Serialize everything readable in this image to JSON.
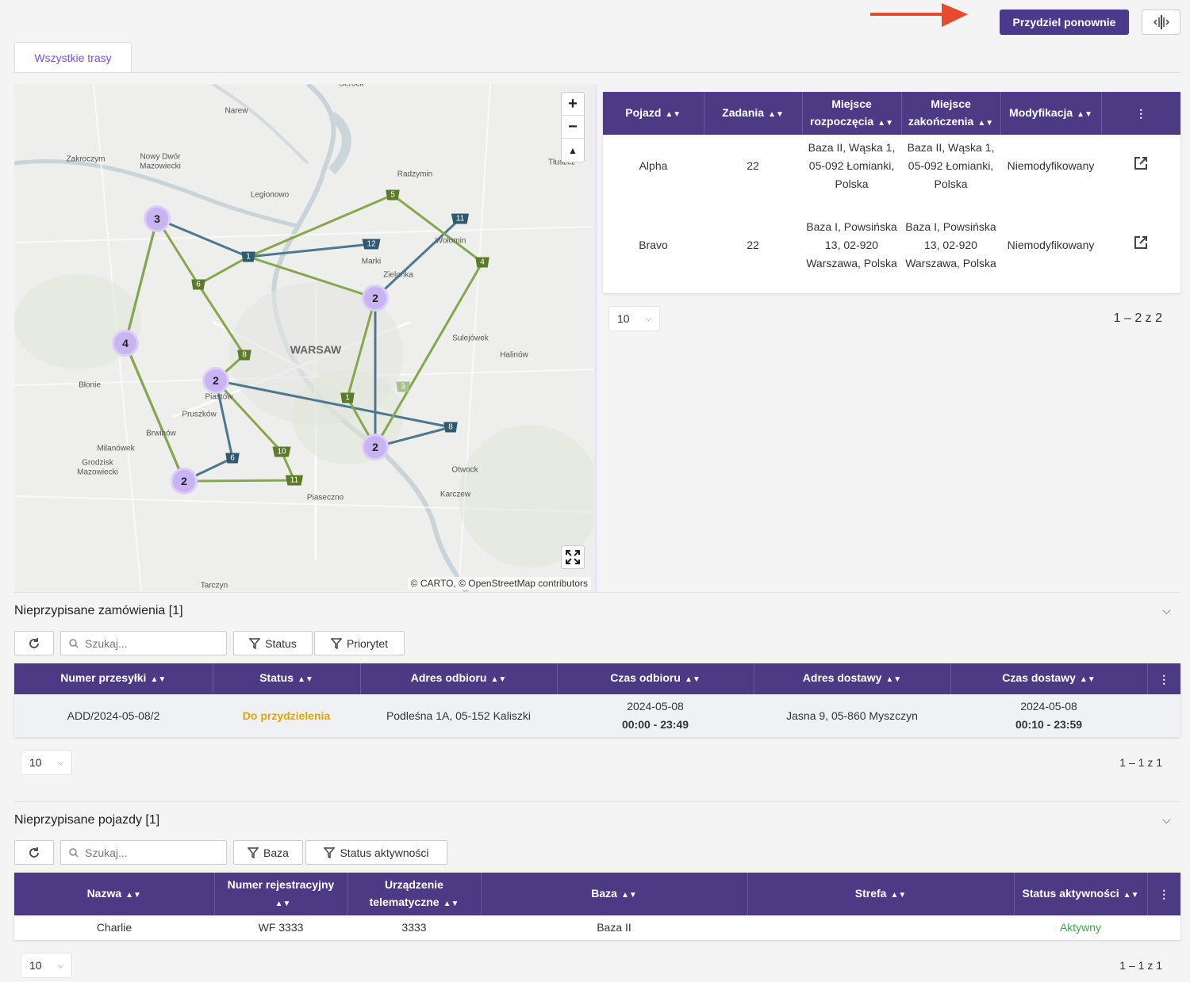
{
  "header": {
    "reassign_label": "Przydziel ponownie",
    "split_icon": "split-view-icon"
  },
  "tabs": [
    {
      "label": "Wszystkie trasy"
    }
  ],
  "map": {
    "attribution": "© CARTO, © OpenStreetMap contributors",
    "zoom_in": "+",
    "zoom_out": "−",
    "north": "▲",
    "places": [
      {
        "name": "Serock"
      },
      {
        "name": "Narew"
      },
      {
        "name": "Zakroczym"
      },
      {
        "name": "Nowy Dwór"
      },
      {
        "name": "Mazowiecki"
      },
      {
        "name": "Radzymin"
      },
      {
        "name": "Tłuszcz"
      },
      {
        "name": "Legionowo"
      },
      {
        "name": "Wołomin"
      },
      {
        "name": "Marki"
      },
      {
        "name": "Zielonka"
      },
      {
        "name": "WARSAW"
      },
      {
        "name": "Sulejówek"
      },
      {
        "name": "Halinów"
      },
      {
        "name": "Błonie"
      },
      {
        "name": "Piastów"
      },
      {
        "name": "Pruszków"
      },
      {
        "name": "Brwinów"
      },
      {
        "name": "Milanówek"
      },
      {
        "name": "Grodzisk"
      },
      {
        "name": "Mazowiecki"
      },
      {
        "name": "Otwock"
      },
      {
        "name": "Karczew"
      },
      {
        "name": "Piaseczno"
      },
      {
        "name": "Tarczyn"
      }
    ],
    "clusters": [
      {
        "count": "3"
      },
      {
        "count": "4"
      },
      {
        "count": "2"
      },
      {
        "count": "2"
      },
      {
        "count": "2"
      },
      {
        "count": "2"
      }
    ],
    "markers": [
      {
        "label": "5",
        "color": "#5b7a2a"
      },
      {
        "label": "11",
        "color": "#2f5a6e"
      },
      {
        "label": "12",
        "color": "#2f5a6e"
      },
      {
        "label": "1",
        "color": "#2f5a6e"
      },
      {
        "label": "4",
        "color": "#5b7a2a"
      },
      {
        "label": "6",
        "color": "#5b7a2a"
      },
      {
        "label": "8",
        "color": "#5b7a2a"
      },
      {
        "label": "1",
        "color": "#5b7a2a"
      },
      {
        "label": "3",
        "color": "#a9c18a"
      },
      {
        "label": "8",
        "color": "#2f5a6e"
      },
      {
        "label": "6",
        "color": "#2f5a6e"
      },
      {
        "label": "10",
        "color": "#5b7a2a"
      },
      {
        "label": "11",
        "color": "#5b7a2a"
      }
    ],
    "colors": {
      "green_route": "#7fa64a",
      "blue_route": "#4d7890",
      "cluster": "#c8b4f2"
    }
  },
  "routes_table": {
    "headers": [
      "Pojazd",
      "Zadania",
      "Miejsce rozpoczęcia",
      "Miejsce zakończenia",
      "Modyfikacja"
    ],
    "rows": [
      {
        "vehicle": "Alpha",
        "tasks": "22",
        "start": "Baza II, Wąska 1, 05-092 Łomianki, Polska",
        "end": "Baza II, Wąska 1, 05-092 Łomianki, Polska",
        "mod": "Niemodyfikowany"
      },
      {
        "vehicle": "Bravo",
        "tasks": "22",
        "start": "Baza I, Powsińska 13, 02-920 Warszawa, Polska",
        "end": "Baza I, Powsińska 13, 02-920 Warszawa, Polska",
        "mod": "Niemodyfikowany"
      }
    ],
    "page_size": "10",
    "range": "1 – 2 z 2"
  },
  "orders": {
    "title": "Nieprzypisane zamówienia [1]",
    "search_placeholder": "Szukaj...",
    "filter_status": "Status",
    "filter_priority": "Priorytet",
    "headers": [
      "Numer przesyłki",
      "Status",
      "Adres odbioru",
      "Czas odbioru",
      "Adres dostawy",
      "Czas dostawy"
    ],
    "rows": [
      {
        "number": "ADD/2024-05-08/2",
        "status": "Do przydzielenia",
        "pickup": "Podleśna 1A, 05-152 Kaliszki",
        "pickup_date": "2024-05-08",
        "pickup_time": "00:00 - 23:49",
        "delivery": "Jasna 9, 05-860 Myszczyn",
        "delivery_date": "2024-05-08",
        "delivery_time": "00:10 - 23:59"
      }
    ],
    "page_size": "10",
    "range": "1 – 1 z 1"
  },
  "vehicles": {
    "title": "Nieprzypisane pojazdy [1]",
    "search_placeholder": "Szukaj...",
    "filter_base": "Baza",
    "filter_activity": "Status aktywności",
    "headers": [
      "Nazwa",
      "Numer rejestracyjny",
      "Urządzenie telematyczne",
      "Baza",
      "Strefa",
      "Status aktywności"
    ],
    "rows": [
      {
        "name": "Charlie",
        "plate": "WF 3333",
        "device": "3333",
        "base": "Baza II",
        "zone": "",
        "status": "Aktywny"
      }
    ],
    "page_size": "10",
    "range": "1 – 1 z 1"
  }
}
